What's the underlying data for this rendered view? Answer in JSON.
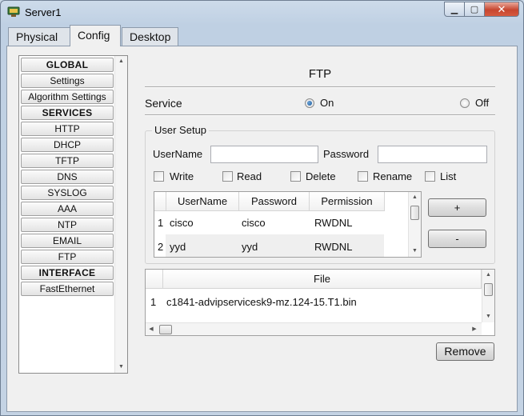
{
  "window": {
    "title": "Server1",
    "icons": {
      "app": "server-icon",
      "minimize": "minimize-icon",
      "maximize": "maximize-icon",
      "close": "close-icon"
    }
  },
  "tabs": [
    "Physical",
    "Config",
    "Desktop"
  ],
  "active_tab": "Config",
  "sidebar": {
    "items": [
      {
        "label": "GLOBAL",
        "header": true
      },
      {
        "label": "Settings"
      },
      {
        "label": "Algorithm Settings"
      },
      {
        "label": "SERVICES",
        "header": true
      },
      {
        "label": "HTTP"
      },
      {
        "label": "DHCP"
      },
      {
        "label": "TFTP"
      },
      {
        "label": "DNS"
      },
      {
        "label": "SYSLOG"
      },
      {
        "label": "AAA"
      },
      {
        "label": "NTP"
      },
      {
        "label": "EMAIL"
      },
      {
        "label": "FTP"
      },
      {
        "label": "INTERFACE",
        "header": true
      },
      {
        "label": "FastEthernet"
      }
    ],
    "selected": "FTP"
  },
  "ftp": {
    "title": "FTP",
    "service_label": "Service",
    "service_on": "On",
    "service_off": "Off",
    "service_state": "On",
    "user_setup_title": "User Setup",
    "username_label": "UserName",
    "password_label": "Password",
    "username_value": "",
    "password_value": "",
    "permissions": [
      {
        "label": "Write",
        "checked": false
      },
      {
        "label": "Read",
        "checked": false
      },
      {
        "label": "Delete",
        "checked": false
      },
      {
        "label": "Rename",
        "checked": false
      },
      {
        "label": "List",
        "checked": false
      }
    ],
    "user_table": {
      "columns": [
        "UserName",
        "Password",
        "Permission"
      ],
      "rows": [
        {
          "index": "1",
          "username": "cisco",
          "password": "cisco",
          "permission": "RWDNL"
        },
        {
          "index": "2",
          "username": "yyd",
          "password": "yyd",
          "permission": "RWDNL"
        }
      ]
    },
    "add_button": "+",
    "remove_user_button": "-",
    "file_table": {
      "column": "File",
      "rows": [
        {
          "index": "1",
          "file": "c1841-advipservicesk9-mz.124-15.T1.bin"
        }
      ]
    },
    "remove_file_button": "Remove"
  }
}
